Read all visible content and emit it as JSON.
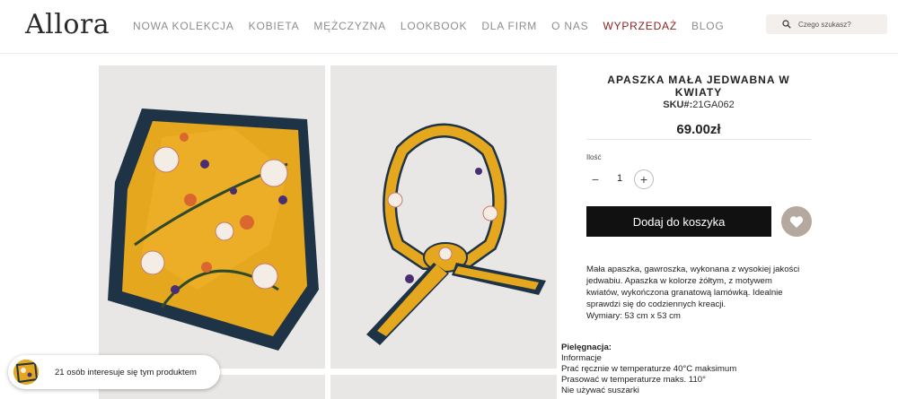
{
  "brand": {
    "logo": "Allora"
  },
  "nav": {
    "items": [
      {
        "label": "NOWA KOLEKCJA",
        "highlight": false
      },
      {
        "label": "KOBIETA",
        "highlight": false
      },
      {
        "label": "MĘŻCZYZNA",
        "highlight": false
      },
      {
        "label": "LOOKBOOK",
        "highlight": false
      },
      {
        "label": "DLA FIRM",
        "highlight": false
      },
      {
        "label": "O NAS",
        "highlight": false
      },
      {
        "label": "WYPRZEDAŻ",
        "highlight": true
      },
      {
        "label": "BLOG",
        "highlight": false
      }
    ]
  },
  "search": {
    "placeholder": "Czego szukasz?",
    "icon": "search-icon"
  },
  "product": {
    "title": "APASZKA MAŁA JEDWABNA W KWIATY",
    "sku_label": "SKU#:",
    "sku_value": "21GA062",
    "price": "69.00zł",
    "quantity_label": "Ilość",
    "quantity": "1",
    "minus": "−",
    "plus": "+",
    "add_to_cart": "Dodaj do koszyka",
    "wishlist_icon": "heart-icon",
    "description": [
      "Mała apaszka, gawroszka, wykonana z wysokiej jakości",
      "jedwabiu. Apaszka w kolorze żółtym, z motywem",
      "kwiatów, wykończona granatową lamówką. Idealnie",
      "sprawdzi się do codziennych kreacji.",
      "Wymiary: 53 cm x 53 cm"
    ],
    "care_heading": "Pielęgnacja:",
    "care": [
      "Informacje",
      "Prać ręcznie w temperaturze 40°C maksimum",
      "Prasować w temperaturze maks. 110°",
      "Nie używać suszarki"
    ]
  },
  "toast": {
    "message": "21 osób interesuje się tym produktem"
  },
  "colors": {
    "accent_sale": "#8a1f1f",
    "button": "#111111",
    "wishlist": "#b5a89e",
    "scarf_yellow": "#e4a71e",
    "scarf_navy": "#1e3346"
  }
}
